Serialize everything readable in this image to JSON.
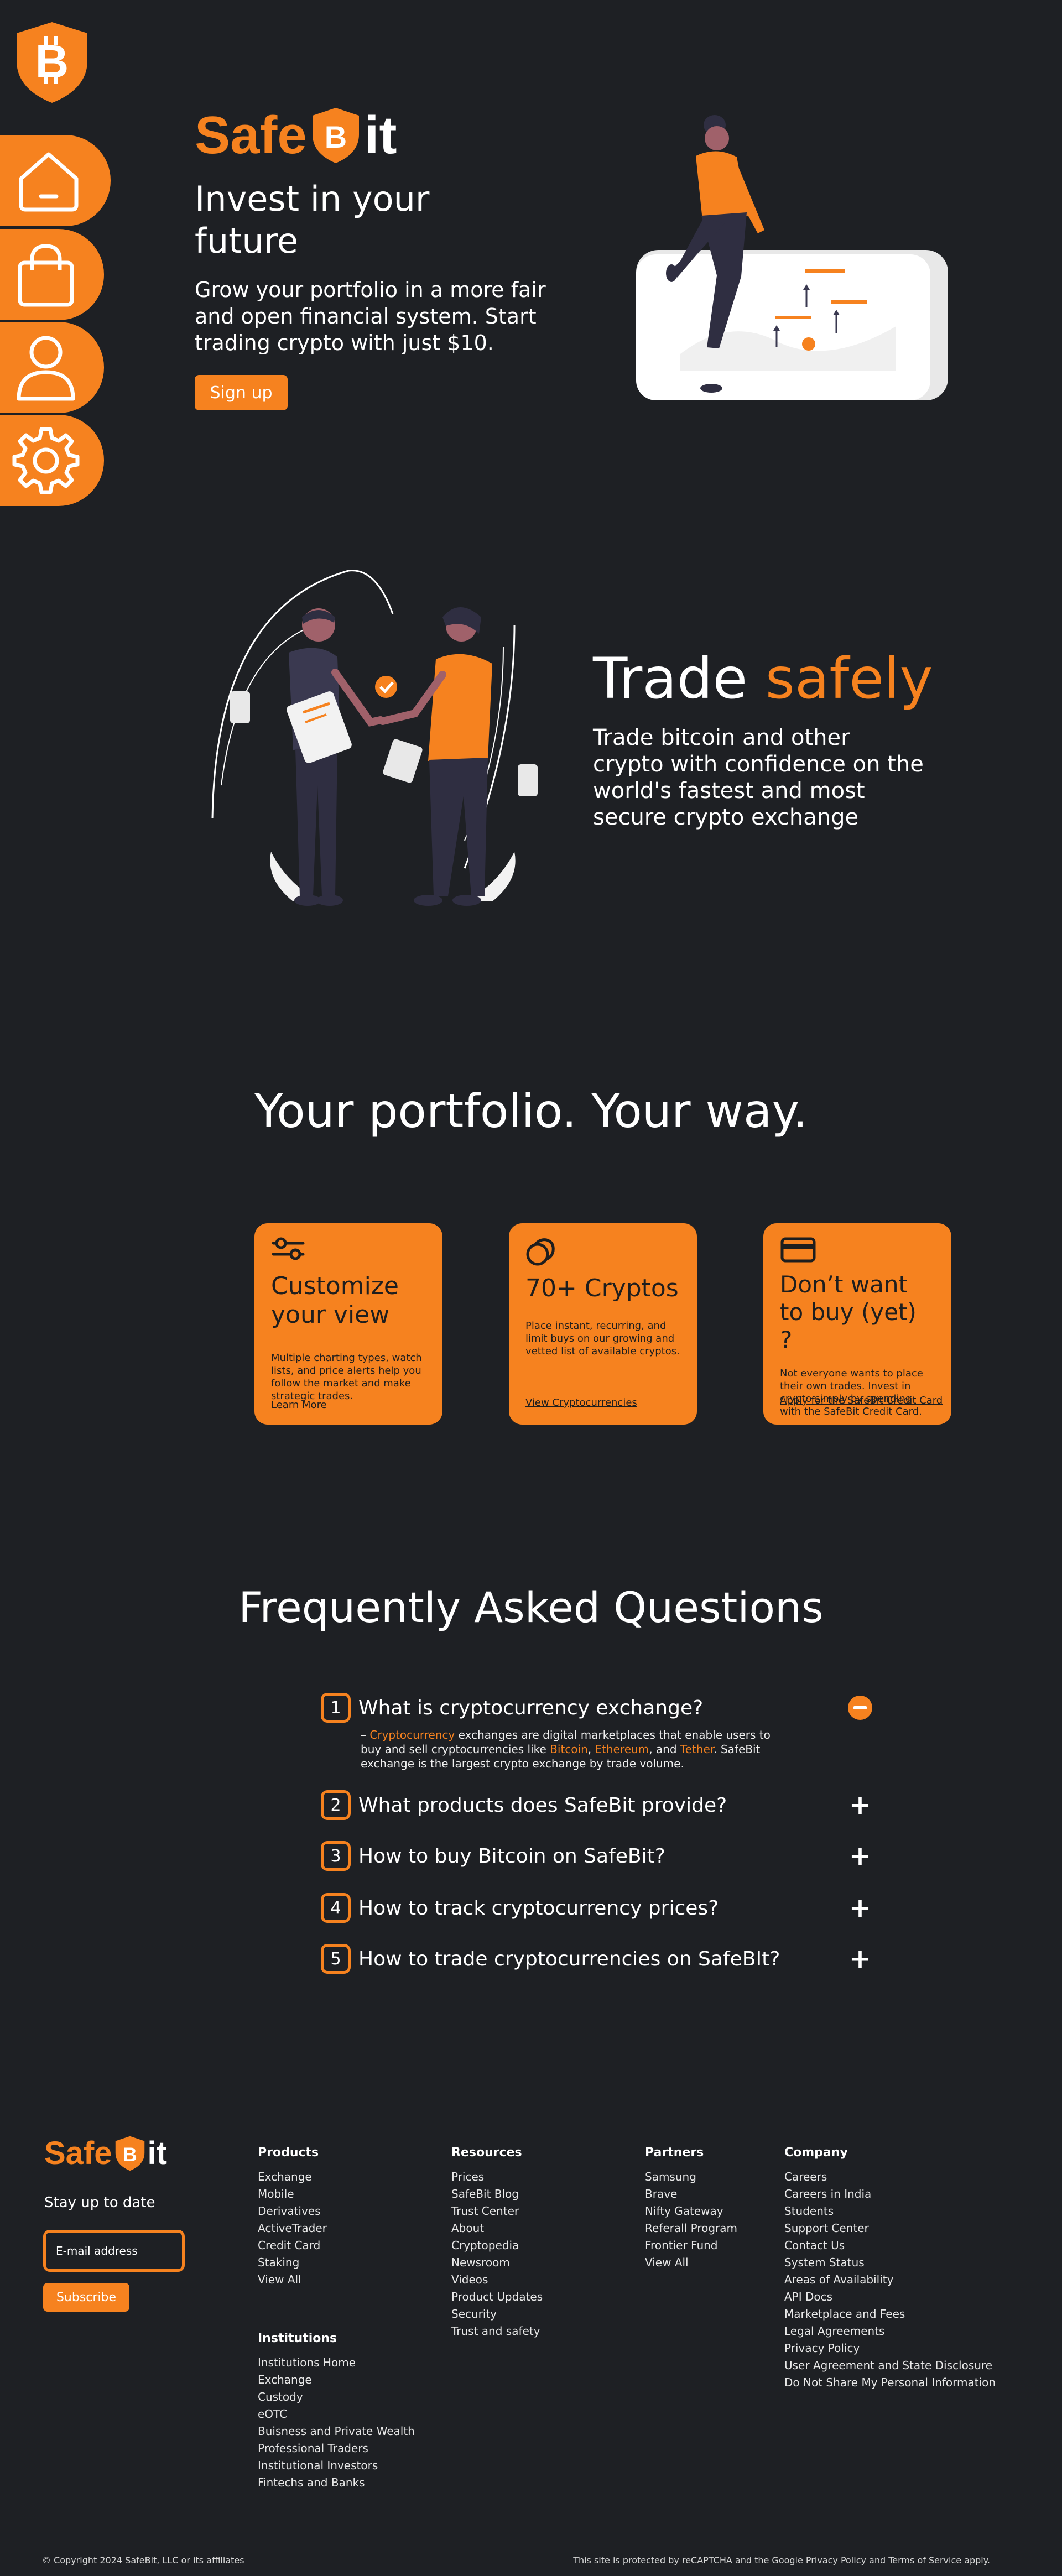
{
  "colors": {
    "accent": "#f6821f",
    "background": "#1e2024",
    "text": "#ffffff"
  },
  "icons": {
    "logo": "bitcoin-shield-icon",
    "nav": [
      "home-icon",
      "shopping-bag-icon",
      "user-icon",
      "gear-icon"
    ]
  },
  "brand": {
    "part1": "Safe",
    "part2": "it",
    "shield_letter": "B"
  },
  "hero": {
    "title": "Invest in your future",
    "subtitle": "Grow your portfolio in a more fair and open financial system. Start trading crypto with just $10.",
    "signup_label": "Sign up"
  },
  "trade": {
    "title_a": "Trade",
    "title_b": "safely",
    "subtitle": "Trade bitcoin and other crypto with confidence on the world's fastest and most secure crypto exchange"
  },
  "portfolio": {
    "title": "Your portfolio. Your way.",
    "cards": [
      {
        "icon": "sliders-icon",
        "title": "Customize your view",
        "text": "Multiple charting types, watch lists, and price alerts help you follow the market and make strategic trades.",
        "link": "Learn More"
      },
      {
        "icon": "coins-icon",
        "title": "70+ Cryptos",
        "text": "Place instant, recurring, and limit buys on our growing and vetted list of available cryptos.",
        "link": "View Cryptocurrencies"
      },
      {
        "icon": "credit-card-icon",
        "title": "Don’t want to buy (yet) ?",
        "text": "Not everyone wants to place their own trades. Invest in crypto simply by spending with the SafeBit Credit Card.",
        "link": "Apply for the SafeBit Credit Card"
      }
    ]
  },
  "faq": {
    "title": "Frequently Asked Questions",
    "items": [
      {
        "num": "1",
        "q": "What is cryptocurrency exchange?",
        "toggle": "−"
      },
      {
        "num": "2",
        "q": "What products does SafeBit provide?",
        "toggle": "+"
      },
      {
        "num": "3",
        "q": "How to buy Bitcoin on SafeBit?",
        "toggle": "+"
      },
      {
        "num": "4",
        "q": "How to track cryptocurrency prices?",
        "toggle": "+"
      },
      {
        "num": "5",
        "q": "How to trade cryptocurrencies on SafeBIt?",
        "toggle": "+"
      }
    ],
    "answer": {
      "dash": "–",
      "w1": "Cryptocurrency",
      "t1": " exchanges are digital marketplaces that enable users to buy and sell cryptocurrencies like ",
      "w2": "Bitcoin",
      "t2": ", ",
      "w3": "Ethereum",
      "t3": ", and ",
      "w4": "Tether",
      "t4": ". SafeBit exchange is the largest crypto exchange by trade volume."
    }
  },
  "footer": {
    "stay": "Stay up to date",
    "email_placeholder": "E-mail address",
    "subscribe": "Subscribe",
    "products": {
      "title": "Products",
      "items": [
        "Exchange",
        "Mobile",
        "Derivatives",
        "ActiveTrader",
        "Credit Card",
        "Staking",
        "View All"
      ]
    },
    "institutions": {
      "title": "Institutions",
      "items": [
        "Institutions Home",
        "Exchange",
        "Custody",
        "eOTC",
        "Buisness and Private Wealth",
        "Professional Traders",
        "Institutional Investors",
        "Fintechs and Banks"
      ]
    },
    "resources": {
      "title": "Resources",
      "items": [
        "Prices",
        "SafeBit Blog",
        "Trust Center",
        "About",
        "Cryptopedia",
        "Newsroom",
        "Videos",
        "Product Updates",
        "Security",
        "Trust and safety"
      ]
    },
    "partners": {
      "title": "Partners",
      "items": [
        "Samsung",
        "Brave",
        "Nifty Gateway",
        "Referall Program",
        "Frontier Fund",
        "View All"
      ]
    },
    "company": {
      "title": "Company",
      "items": [
        "Careers",
        "Careers in India",
        "Students",
        "Support Center",
        "Contact Us",
        "System Status",
        "Areas of Availability",
        "API Docs",
        "Marketplace and Fees",
        "Legal Agreements",
        "Privacy Policy",
        "User Agreement and State Disclosure",
        "Do Not Share My Personal Information"
      ]
    },
    "copyright": "© Copyright 2024 SafeBit, LLC or its affiliates",
    "protected": "This site is protected by reCAPTCHA and the Google Privacy Policy and Terms of Service apply."
  }
}
